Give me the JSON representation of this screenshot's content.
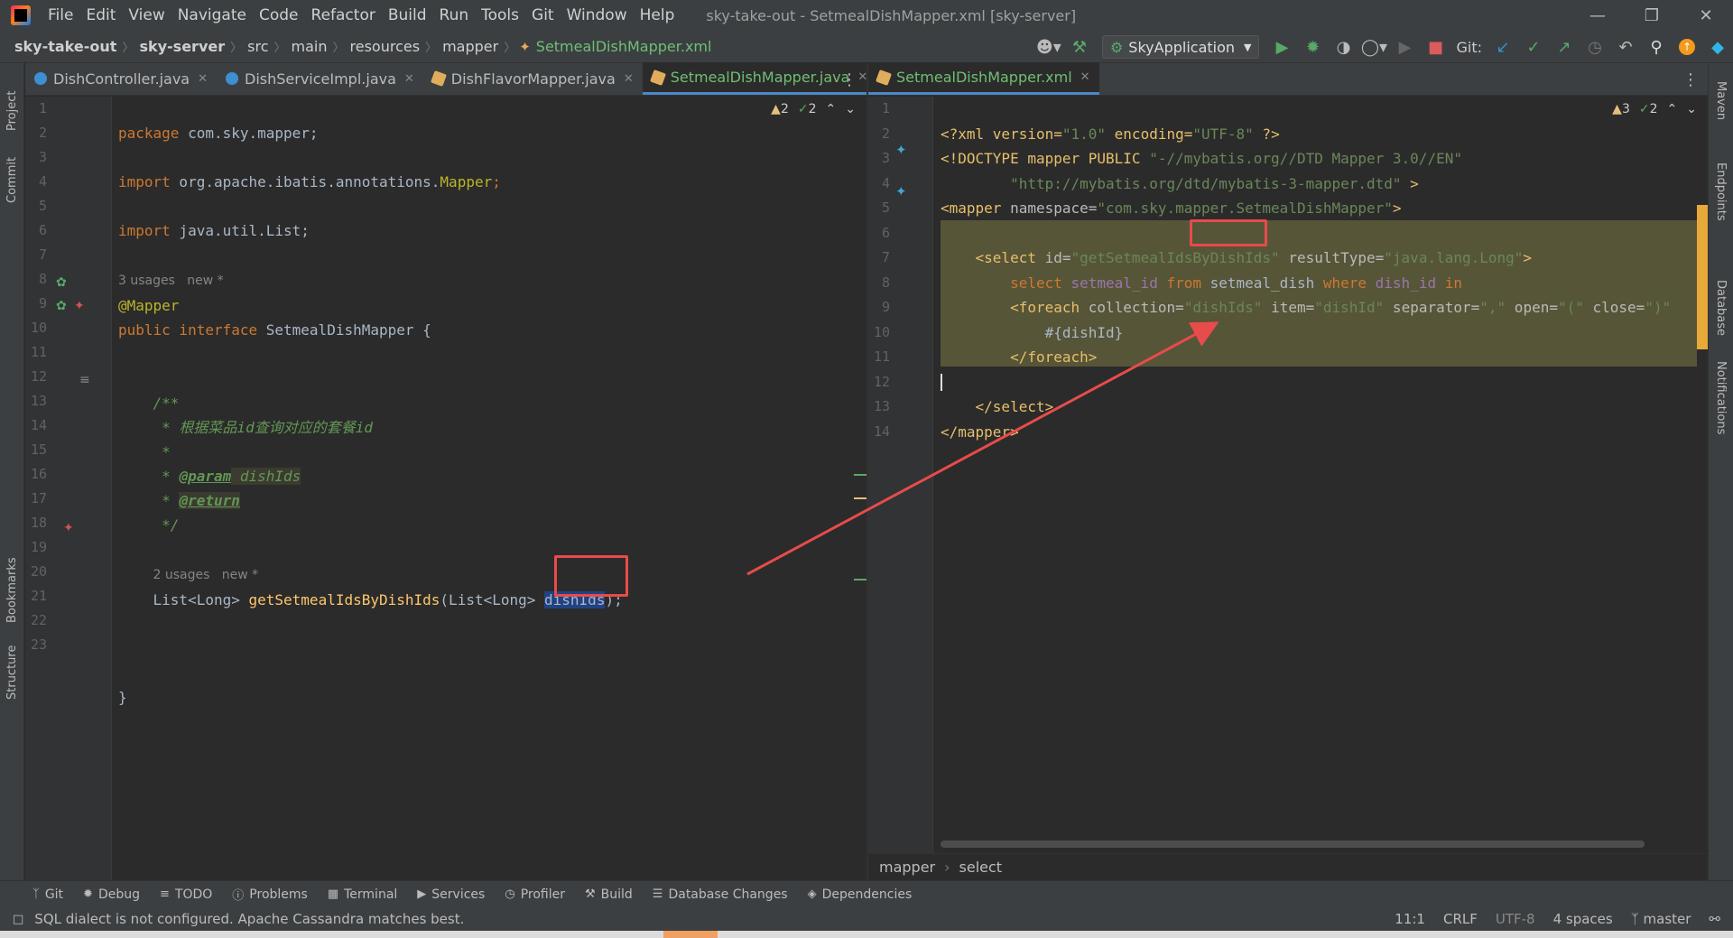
{
  "menu": [
    "File",
    "Edit",
    "View",
    "Navigate",
    "Code",
    "Refactor",
    "Build",
    "Run",
    "Tools",
    "Git",
    "Window",
    "Help"
  ],
  "window_title": "sky-take-out - SetmealDishMapper.xml [sky-server]",
  "breadcrumb": [
    "sky-take-out",
    "sky-server",
    "src",
    "main",
    "resources",
    "mapper",
    "SetmealDishMapper.xml"
  ],
  "run_config": "SkyApplication",
  "git_label": "Git:",
  "left_tabs": [
    {
      "label": "DishController.java",
      "type": "java"
    },
    {
      "label": "DishServiceImpl.java",
      "type": "java"
    },
    {
      "label": "DishFlavorMapper.java",
      "type": "mapper"
    },
    {
      "label": "SetmealDishMapper.java",
      "type": "mapper",
      "active": true
    }
  ],
  "right_tabs": [
    {
      "label": "SetmealDishMapper.xml",
      "active": true
    }
  ],
  "left_editor": {
    "warnings": "2",
    "checks": "2",
    "line_numbers": [
      "1",
      "2",
      "3",
      "4",
      "5",
      "6",
      "7",
      "8",
      "9",
      "10",
      "11",
      "12",
      "13",
      "14",
      "15",
      "16",
      "17",
      "18",
      "19",
      "20",
      "21",
      "22",
      "23"
    ],
    "code": {
      "l1_kw": "package",
      "l1_rest": " com.sky.mapper;",
      "l3_kw": "import",
      "l3_rest": " org.apache.ibatis.annotations.",
      "l3_ann": "Mapper",
      ";": ";",
      "l5_kw": "import",
      "l5_rest": " java.util.List;",
      "hint1": "3 usages   new *",
      "l7": "@Mapper",
      "l8_kw": "public interface",
      "l8_rest": " SetmealDishMapper {",
      "l11": "/**",
      "l12": " * 根据菜品id查询对应的套餐id",
      "l13": " *",
      "l14_a": " * ",
      "l14_tag": "@param",
      "l14_b": " dishIds",
      "l15_a": " * ",
      "l15_tag": "@return",
      "l16": " */",
      "hint2": "2 usages   new *",
      "l18_a": "List<Long> ",
      "l18_fn": "getSetmealIdsByDishIds",
      "l18_b": "(List<Long> ",
      "l18_sel": "dishIds",
      "l18_c": ");",
      "l22": "}"
    }
  },
  "right_editor": {
    "warnings": "3",
    "checks": "2",
    "line_numbers": [
      "1",
      "2",
      "3",
      "4",
      "5",
      "6",
      "7",
      "8",
      "9",
      "10",
      "11",
      "12",
      "13",
      "14"
    ],
    "code": {
      "r1_a": "<?xml version=",
      "r1_s1": "\"1.0\"",
      "r1_b": " encoding=",
      "r1_s2": "\"UTF-8\"",
      "r1_c": " ?>",
      "r2_a": "<!DOCTYPE mapper PUBLIC ",
      "r2_s": "\"-//mybatis.org//DTD Mapper 3.0//EN\"",
      "r3_s": "\"http://mybatis.org/dtd/mybatis-3-mapper.dtd\"",
      "r3_c": " >",
      "r4_tag": "<mapper ",
      "r4_attr": "namespace=",
      "r4_s": "\"com.sky.mapper.SetmealDishMapper\"",
      "r4_end": ">",
      "r6_tag": "<select ",
      "r6_a1": "id=",
      "r6_s1": "\"getSetmealIdsByDishIds\"",
      "r6_a2": " resultType=",
      "r6_s2": "\"java.lang.Long\"",
      "r6_end": ">",
      "r7_kw1": "select",
      "r7_a": " setmeal_id ",
      "r7_kw2": "from",
      "r7_b": " setmeal_dish ",
      "r7_kw3": "where",
      "r7_c": " dish_id ",
      "r7_kw4": "in",
      "r8_tag": "<foreach ",
      "r8_a1": "collection=",
      "r8_s1": "\"dishIds\"",
      "r8_a2": " item=",
      "r8_s2": "\"dishId\"",
      "r8_a3": " separator=",
      "r8_s3": "\",\"",
      "r8_a4": " open=",
      "r8_s4": "\"(\"",
      "r8_a5": " close=",
      "r8_s5": "\")\"",
      "r9": "#{dishId}",
      "r10": "</foreach>",
      "r12": "</select>",
      "r13": "</mapper>"
    },
    "breadcrumb": [
      "mapper",
      "select"
    ]
  },
  "left_stripe": [
    "Project",
    "Commit",
    "Bookmarks",
    "Structure"
  ],
  "right_stripe": [
    "Maven",
    "Endpoints",
    "Database",
    "Notifications"
  ],
  "bottom_tools": [
    "Git",
    "Debug",
    "TODO",
    "Problems",
    "Terminal",
    "Services",
    "Profiler",
    "Build",
    "Database Changes",
    "Dependencies"
  ],
  "status": {
    "message": "SQL dialect is not configured. Apache Cassandra matches best.",
    "position": "11:1",
    "line_sep": "CRLF",
    "encoding": "UTF-8",
    "indent": "4 spaces",
    "branch": "master"
  },
  "colors": {
    "annotation_red": "#e84b4b",
    "selection": "#214283",
    "highlight": "#575537"
  }
}
